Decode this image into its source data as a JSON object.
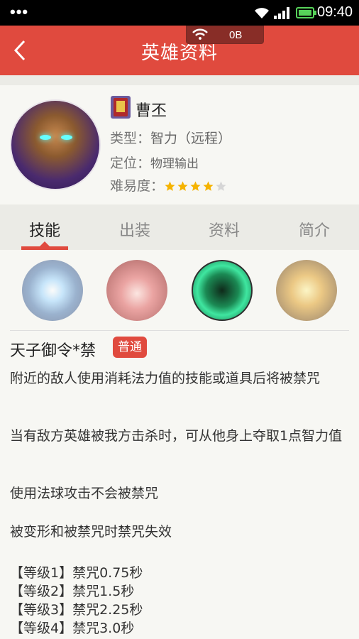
{
  "status_bar": {
    "dots": "•••",
    "time": "09:40"
  },
  "app_bar": {
    "title": "英雄资料",
    "net_rate": "0B",
    "back_icon": "chevron-left-icon"
  },
  "hero": {
    "name": "曹丕",
    "type_label": "类型：",
    "type_value": "智力（远程）",
    "role_label": "定位：",
    "role_value": "物理输出",
    "difficulty_label": "难易度：",
    "difficulty_stars": 4,
    "difficulty_max": 5
  },
  "tabs": [
    {
      "label": "技能",
      "active": true
    },
    {
      "label": "出装",
      "active": false
    },
    {
      "label": "资料",
      "active": false
    },
    {
      "label": "简介",
      "active": false
    }
  ],
  "skill_icons": [
    "skill-icon-1",
    "skill-icon-2",
    "skill-icon-3",
    "skill-icon-4"
  ],
  "selected_skill": {
    "name": "天子御令*禁",
    "type": "普通",
    "paragraphs": [
      "附近的敌人使用消耗法力值的技能或道具后将被禁咒",
      "当有敌方英雄被我方击杀时，可从他身上夺取1点智力值",
      "使用法球攻击不会被禁咒",
      "被变形和被禁咒时禁咒失效"
    ],
    "levels": [
      "【等级1】禁咒0.75秒",
      "【等级2】禁咒1.5秒",
      "【等级3】禁咒2.25秒",
      "【等级4】禁咒3.0秒"
    ]
  },
  "colors": {
    "accent": "#e04a3e",
    "star": "#f5b300",
    "star_empty": "#d6d6d6"
  }
}
